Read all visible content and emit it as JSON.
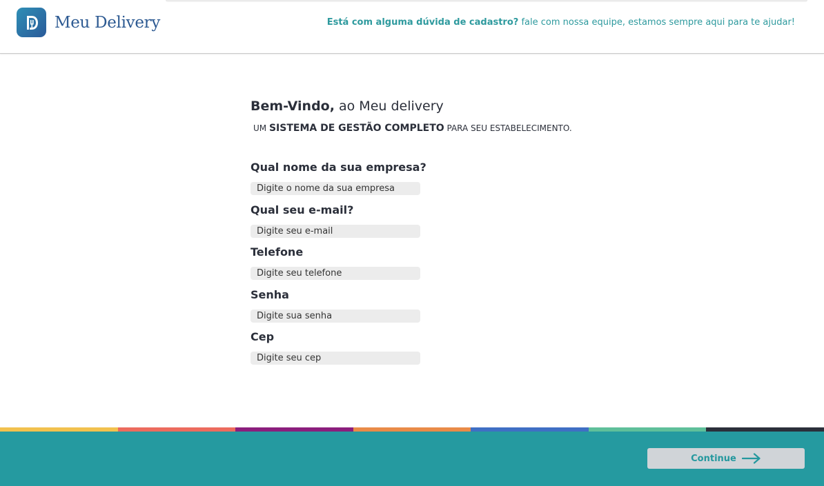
{
  "header": {
    "app_name": "Meu Delivery",
    "help_bold": "Está com alguma dúvida de cadastro?",
    "help_text": " fale com nossa equipe, estamos sempre aqui para te ajudar!"
  },
  "intro": {
    "welcome_bold": "Bem-Vindo,",
    "welcome_rest": " ao Meu delivery",
    "tagline_pre": "um ",
    "tagline_bold": "SISTEMA DE GESTÃO COMPLETO",
    "tagline_post": " para seu  estabelecimento."
  },
  "form": {
    "fields": [
      {
        "label": "Qual nome da sua empresa?",
        "placeholder": "Digite o nome da sua empresa"
      },
      {
        "label": "Qual seu e-mail?",
        "placeholder": "Digite seu e-mail"
      },
      {
        "label": "Telefone",
        "placeholder": "Digite seu telefone"
      },
      {
        "label": "Senha",
        "placeholder": "Digite sua senha"
      },
      {
        "label": "Cep",
        "placeholder": "Digite seu cep"
      }
    ]
  },
  "footer": {
    "continue_label": "Continue",
    "stripe_colors": [
      "#f2c14e",
      "#ec6b5e",
      "#8b1e7d",
      "#e98b48",
      "#3f6fc4",
      "#5fbf9a",
      "#2b2f3a"
    ]
  },
  "colors": {
    "brand": "#2d5a92",
    "accent": "#259aa0"
  },
  "icons": {
    "logo": "logo-icon",
    "continue": "arrow-right-icon"
  }
}
